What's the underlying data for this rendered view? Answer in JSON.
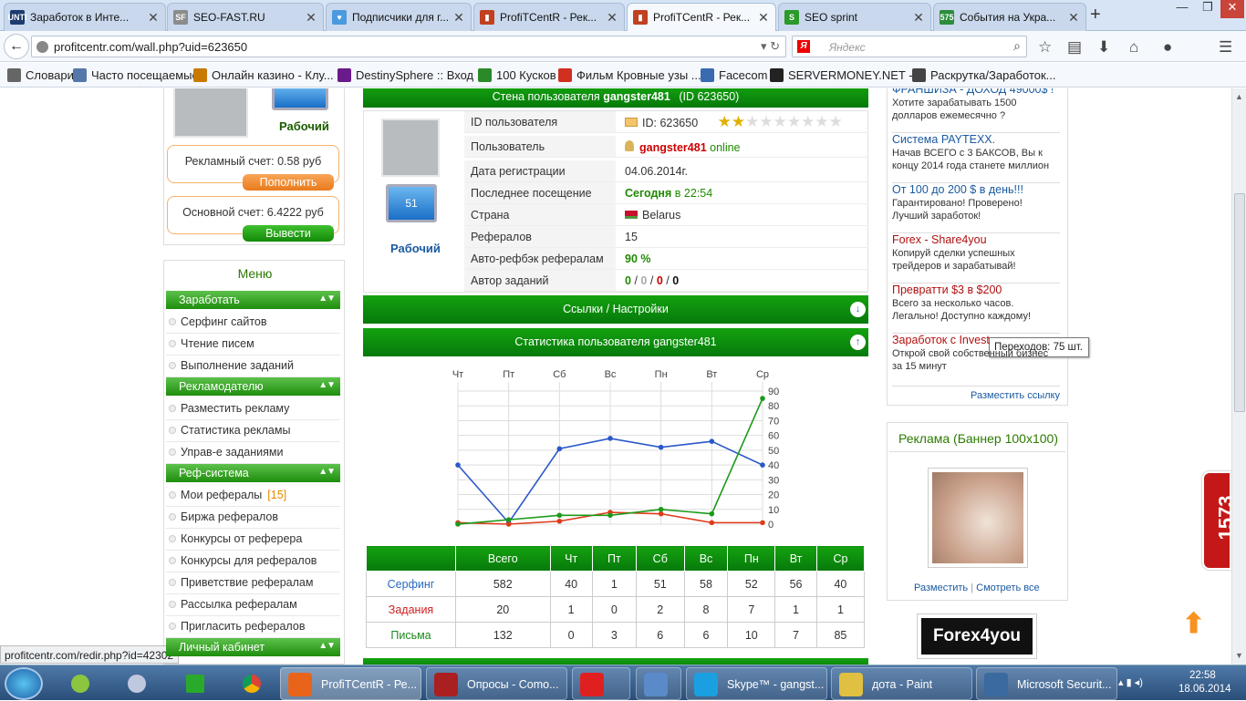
{
  "browser": {
    "tabs": [
      {
        "label": "Заработок в Инте...",
        "icon_color": "#1c3b6e",
        "icon_text": "UNTI"
      },
      {
        "label": "SEO-FAST.RU",
        "icon_color": "#8c8c8c",
        "icon_text": "SF"
      },
      {
        "label": "Подписчики для г...",
        "icon_color": "#4b9ae0",
        "icon_text": "♥"
      },
      {
        "label": "ProfiTCentR - Рек...",
        "icon_color": "#c04020",
        "icon_text": "▮"
      },
      {
        "label": "ProfiTCentR - Рек...",
        "icon_color": "#c04020",
        "icon_text": "▮",
        "active": true
      },
      {
        "label": "SEO sprint",
        "icon_color": "#2a9a2a",
        "icon_text": "S"
      },
      {
        "label": "События на Укра...",
        "icon_color": "#2c8c3c",
        "icon_text": "575"
      }
    ],
    "url": "profitcentr.com/wall.php?uid=623650",
    "search_placeholder": "Яндекс",
    "search_engine_icon": "Я",
    "bookmarks": [
      {
        "label": "Словари",
        "color": "#666"
      },
      {
        "label": "Часто посещаемые",
        "color": "#5577aa"
      },
      {
        "label": "Онлайн казино - Клу...",
        "color": "#c87a00"
      },
      {
        "label": "DestinySphere :: Вход ...",
        "color": "#6a1a8a"
      },
      {
        "label": "100 Кусков",
        "color": "#2a8a2a"
      },
      {
        "label": "Фильм Кровные узы ...",
        "color": "#d03020"
      },
      {
        "label": "Facecom",
        "color": "#3a6ab0"
      },
      {
        "label": "SERVERMONEY.NET - ...",
        "color": "#222"
      },
      {
        "label": "Раскрутка/Заработок...",
        "color": "#444"
      }
    ]
  },
  "profile": {
    "wall_title_prefix": "Стена пользователя",
    "username": "gangster481",
    "wall_id": "(ID 623650)",
    "monitor_value": "51",
    "role": "Рабочий",
    "rows": {
      "id_label": "ID пользователя",
      "id_value": "ID: 623650",
      "user_label": "Пользователь",
      "user_status": "online",
      "reg_label": "Дата регистрации",
      "reg_value": "04.06.2014г.",
      "last_label": "Последнее посещение",
      "last_today": "Сегодня",
      "last_time": "в 22:54",
      "country_label": "Страна",
      "country_value": "Belarus",
      "refs_label": "Рефералов",
      "refs_value": "15",
      "refback_label": "Авто-рефбэк рефералам",
      "refback_value": "90",
      "refback_unit": "%",
      "tasks_label": "Автор заданий",
      "tasks_values": [
        "0",
        "0",
        "0",
        "0"
      ],
      "tasks_sep": "/",
      "rating": 2,
      "rating_max": 10
    }
  },
  "left": {
    "role": "Рабочий",
    "ad_account": "Рекламный счет: 0.58 руб",
    "topup": "Пополнить",
    "main_account": "Основной счет: 6.4222 руб",
    "withdraw": "Вывести",
    "menu_title": "Меню",
    "sections": [
      {
        "title": "Заработать",
        "items": [
          "Серфинг сайтов",
          "Чтение писем",
          "Выполнение заданий"
        ]
      },
      {
        "title": "Рекламодателю",
        "items": [
          "Разместить рекламу",
          "Статистика рекламы",
          "Управ-е заданиями"
        ]
      },
      {
        "title": "Реф-система",
        "items": [
          "Мои рефералы",
          "Биржа рефералов",
          "Конкурсы от реферера",
          "Конкурсы для рефералов",
          "Приветствие рефералам",
          "Рассылка рефералам",
          "Пригласить рефералов"
        ]
      },
      {
        "title": "Личный кабинет",
        "items": []
      }
    ],
    "refs_count": "[15]",
    "status_url": "profitcentr.com/redir.php?id=42302"
  },
  "bars": {
    "links": "Ссылки / Настройки",
    "stats": "Статистика пользователя gangster481"
  },
  "chart_data": {
    "type": "line",
    "categories": [
      "Чт",
      "Пт",
      "Сб",
      "Вс",
      "Пн",
      "Вт",
      "Ср"
    ],
    "ylim": [
      0,
      90
    ],
    "yticks": [
      "0",
      "10",
      "20",
      "30",
      "40",
      "50",
      "60",
      "70",
      "80",
      "90"
    ],
    "grid": true,
    "series": [
      {
        "name": "Серфинг",
        "color": "#2a58c8",
        "values": [
          40,
          1,
          51,
          58,
          52,
          56,
          40
        ]
      },
      {
        "name": "Задания",
        "color": "#e03a1a",
        "values": [
          1,
          0,
          2,
          8,
          7,
          1,
          1
        ]
      },
      {
        "name": "Письма",
        "color": "#1b9a1b",
        "values": [
          0,
          3,
          6,
          6,
          10,
          7,
          85
        ]
      }
    ]
  },
  "stats_table": {
    "headers": [
      "",
      "Всего",
      "Чт",
      "Пт",
      "Сб",
      "Вс",
      "Пн",
      "Вт",
      "Ср"
    ],
    "rows": [
      {
        "label": "Серфинг",
        "color": "#2a6ac0",
        "cells": [
          "582",
          "40",
          "1",
          "51",
          "58",
          "52",
          "56",
          "40"
        ]
      },
      {
        "label": "Задания",
        "color": "#d02020",
        "cells": [
          "20",
          "1",
          "0",
          "2",
          "8",
          "7",
          "1",
          "1"
        ]
      },
      {
        "label": "Письма",
        "color": "#1b8a1b",
        "cells": [
          "132",
          "0",
          "3",
          "6",
          "6",
          "10",
          "7",
          "85"
        ]
      }
    ]
  },
  "right": {
    "ads": [
      {
        "title": "ФРАНШИЗА - ДОХОД 49000$ !",
        "title_color": "#1a5aa0",
        "text": "Хотите зарабатывать 1500 долларов ежемесячно ?"
      },
      {
        "title": "Система PAYTEXX.",
        "title_color": "#1a5aa0",
        "text": "Начав ВСЕГО с 3 БАКСОВ, Вы к концу 2014 года станете миллион"
      },
      {
        "title": "От 100 до 200 $ в день!!!",
        "title_color": "#1a5aa0",
        "text": "Гарантировано! Проверено! Лучший заработок!"
      },
      {
        "title": "Forex - Share4you",
        "title_color": "#b01010",
        "text": "Копируй сделки успешных трейдеров и зарабатывай!"
      },
      {
        "title": "Превратти $3 в $200",
        "title_color": "#b01010",
        "text": "Всего за несколько часов. Легально! Доступно каждому!"
      },
      {
        "title": "Заработок с Invest",
        "title_color": "#b01010",
        "text": "Открой свой собственный бизнес за 15 минут"
      }
    ],
    "place_link": "Разместить ссылку",
    "banner_title": "Реклама (Баннер 100х100)",
    "banner_place": "Разместить",
    "banner_sep": "|",
    "banner_all": "Смотреть все",
    "tooltip": "Переходов: 75 шт.",
    "forex_logo": "Forex4you",
    "side_counter": "1573"
  },
  "taskbar": {
    "tasks": [
      {
        "label": "ProfiTCentR - Ре...",
        "color": "#e8641a",
        "active": true
      },
      {
        "label": "Опросы - Сomo...",
        "color": "#aa2020"
      },
      {
        "label": "",
        "color": "#e02020"
      },
      {
        "label": "",
        "color": "#5a8ac8"
      },
      {
        "label": "Skype™ - gangst...",
        "color": "#1aa0e0"
      },
      {
        "label": "дота - Paint",
        "color": "#e0c040"
      },
      {
        "label": "Microsoft Securit...",
        "color": "#3a6aa0"
      }
    ],
    "time": "22:58",
    "date": "18.06.2014"
  }
}
